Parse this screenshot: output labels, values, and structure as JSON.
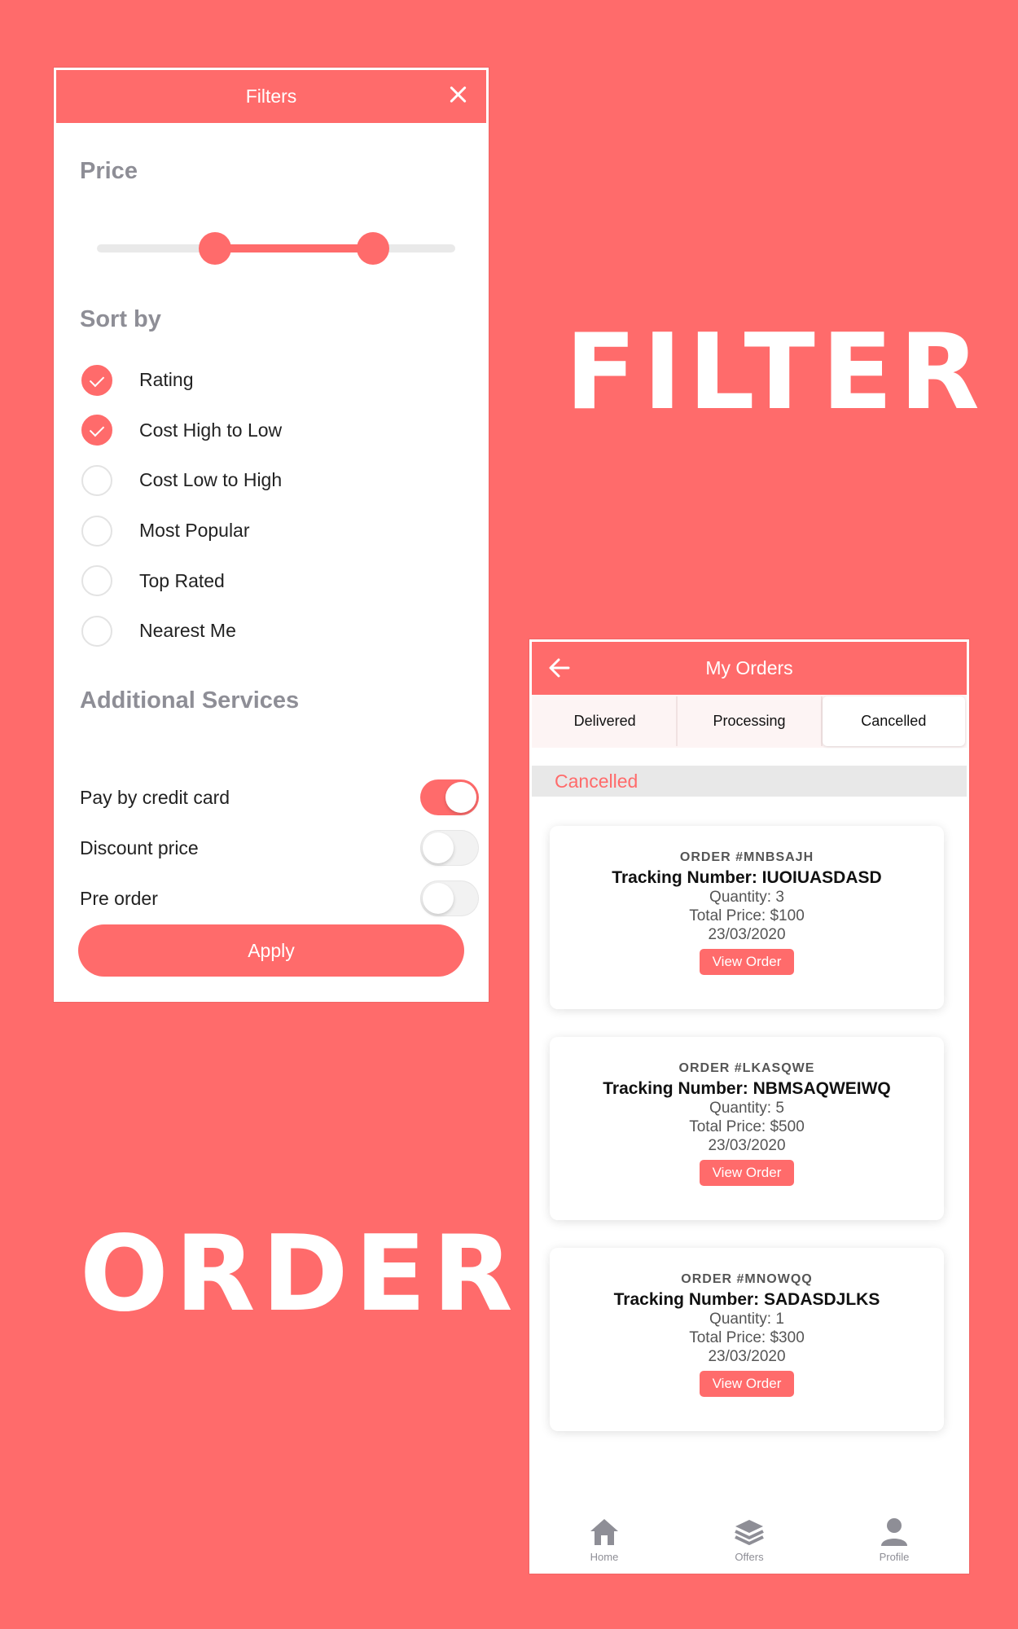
{
  "headlines": {
    "filter": "FILTER",
    "order": "ORDER"
  },
  "filters": {
    "title": "Filters",
    "price_title": "Price",
    "price_range": {
      "low_fraction": 0.33,
      "high_fraction": 0.77
    },
    "sort_title": "Sort by",
    "sort_options": [
      {
        "label": "Rating",
        "checked": true
      },
      {
        "label": "Cost High to Low",
        "checked": true
      },
      {
        "label": "Cost Low to High",
        "checked": false
      },
      {
        "label": "Most Popular",
        "checked": false
      },
      {
        "label": "Top Rated",
        "checked": false
      },
      {
        "label": "Nearest Me",
        "checked": false
      }
    ],
    "services_title": "Additional Services",
    "services": [
      {
        "label": "Pay by credit card",
        "on": true
      },
      {
        "label": "Discount price",
        "on": false
      },
      {
        "label": "Pre order",
        "on": false
      }
    ],
    "apply_label": "Apply"
  },
  "orders": {
    "title": "My Orders",
    "tabs": [
      {
        "label": "Delivered",
        "active": false
      },
      {
        "label": "Processing",
        "active": false
      },
      {
        "label": "Cancelled",
        "active": true
      }
    ],
    "section_label": "Cancelled",
    "cards": [
      {
        "order": "ORDER #MNBSAJH",
        "tracking": "Tracking Number: IUOIUASDASD",
        "quantity": "Quantity: 3",
        "total": "Total Price: $100",
        "date": "23/03/2020",
        "button": "View Order"
      },
      {
        "order": "ORDER #LKASQWE",
        "tracking": "Tracking Number: NBMSAQWEIWQ",
        "quantity": "Quantity: 5",
        "total": "Total Price: $500",
        "date": "23/03/2020",
        "button": "View Order"
      },
      {
        "order": "ORDER #MNOWQQ",
        "tracking": "Tracking Number: SADASDJLKS",
        "quantity": "Quantity: 1",
        "total": "Total Price: $300",
        "date": "23/03/2020",
        "button": "View Order"
      }
    ],
    "nav": [
      {
        "label": "Home",
        "icon": "home-icon"
      },
      {
        "label": "Offers",
        "icon": "layers-icon"
      },
      {
        "label": "Profile",
        "icon": "user-icon"
      }
    ]
  },
  "colors": {
    "accent": "#FF6B6B",
    "muted": "#8e8e96"
  }
}
